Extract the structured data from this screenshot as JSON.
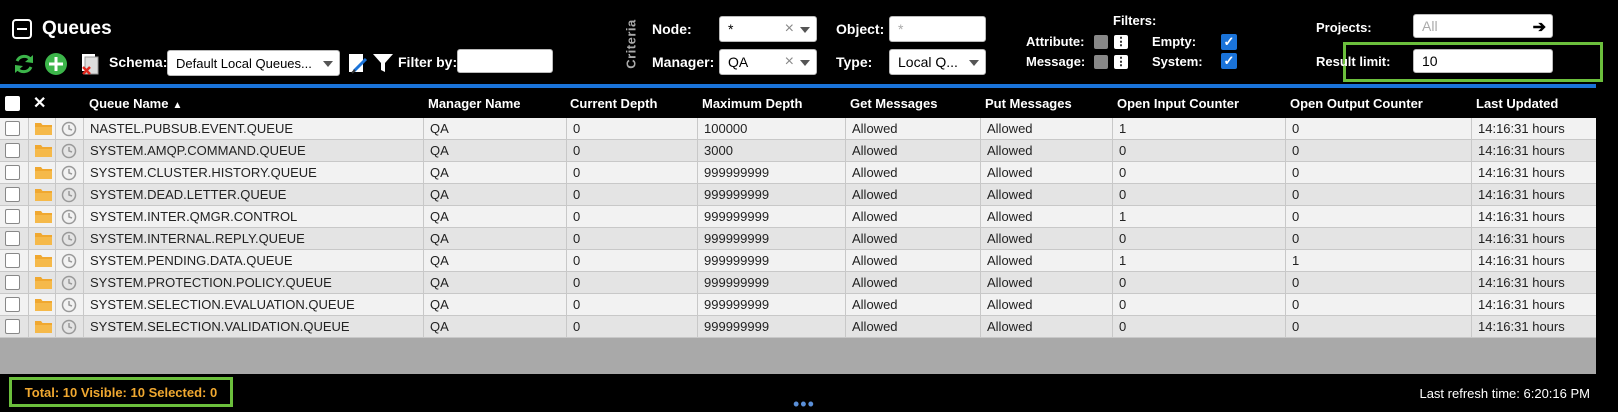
{
  "header": {
    "title": "Queues",
    "schema_label": "Schema:",
    "schema_value": "Default Local Queues...",
    "filter_by_label": "Filter by:",
    "filter_by_value": "",
    "criteria_label": "Criteria",
    "node_label": "Node:",
    "node_value": "*",
    "manager_label": "Manager:",
    "manager_value": "QA",
    "object_label": "Object:",
    "object_placeholder": "*",
    "type_label": "Type:",
    "type_value": "Local Q...",
    "filters_label": "Filters:",
    "attribute_label": "Attribute:",
    "message_label": "Message:",
    "empty_label": "Empty:",
    "system_label": "System:",
    "empty_checked": true,
    "system_checked": true,
    "projects_label": "Projects:",
    "projects_placeholder": "All",
    "result_limit_label": "Result limit:",
    "result_limit_value": "10"
  },
  "grid": {
    "columns": [
      "Queue Name",
      "Manager Name",
      "Current Depth",
      "Maximum Depth",
      "Get Messages",
      "Put Messages",
      "Open Input Counter",
      "Open Output Counter",
      "Last Updated"
    ],
    "rows": [
      [
        "NASTEL.PUBSUB.EVENT.QUEUE",
        "QA",
        "0",
        "100000",
        "Allowed",
        "Allowed",
        "1",
        "0",
        "14:16:31 hours"
      ],
      [
        "SYSTEM.AMQP.COMMAND.QUEUE",
        "QA",
        "0",
        "3000",
        "Allowed",
        "Allowed",
        "0",
        "0",
        "14:16:31 hours"
      ],
      [
        "SYSTEM.CLUSTER.HISTORY.QUEUE",
        "QA",
        "0",
        "999999999",
        "Allowed",
        "Allowed",
        "0",
        "0",
        "14:16:31 hours"
      ],
      [
        "SYSTEM.DEAD.LETTER.QUEUE",
        "QA",
        "0",
        "999999999",
        "Allowed",
        "Allowed",
        "0",
        "0",
        "14:16:31 hours"
      ],
      [
        "SYSTEM.INTER.QMGR.CONTROL",
        "QA",
        "0",
        "999999999",
        "Allowed",
        "Allowed",
        "1",
        "0",
        "14:16:31 hours"
      ],
      [
        "SYSTEM.INTERNAL.REPLY.QUEUE",
        "QA",
        "0",
        "999999999",
        "Allowed",
        "Allowed",
        "0",
        "0",
        "14:16:31 hours"
      ],
      [
        "SYSTEM.PENDING.DATA.QUEUE",
        "QA",
        "0",
        "999999999",
        "Allowed",
        "Allowed",
        "1",
        "1",
        "14:16:31 hours"
      ],
      [
        "SYSTEM.PROTECTION.POLICY.QUEUE",
        "QA",
        "0",
        "999999999",
        "Allowed",
        "Allowed",
        "0",
        "0",
        "14:16:31 hours"
      ],
      [
        "SYSTEM.SELECTION.EVALUATION.QUEUE",
        "QA",
        "0",
        "999999999",
        "Allowed",
        "Allowed",
        "0",
        "0",
        "14:16:31 hours"
      ],
      [
        "SYSTEM.SELECTION.VALIDATION.QUEUE",
        "QA",
        "0",
        "999999999",
        "Allowed",
        "Allowed",
        "0",
        "0",
        "14:16:31 hours"
      ]
    ]
  },
  "footer": {
    "status": "Total: 10 Visible: 10 Selected: 0",
    "last_refresh": "Last refresh time: 6:20:16 PM"
  },
  "icons": {
    "collapse": "collapse-square-icon",
    "refresh": "refresh-icon",
    "add": "add-circle-icon",
    "delete_doc": "delete-document-icon",
    "edit_schema": "edit-schema-icon",
    "filter": "filter-funnel-icon",
    "projects_go": "arrow-right-icon",
    "folder": "folder-icon",
    "clock": "clock-icon"
  },
  "colors": {
    "accent_blue": "#1a73d9",
    "highlight_green": "#6bbf3c",
    "status_orange": "#f0a830",
    "folder_orange": "#f0a830"
  }
}
